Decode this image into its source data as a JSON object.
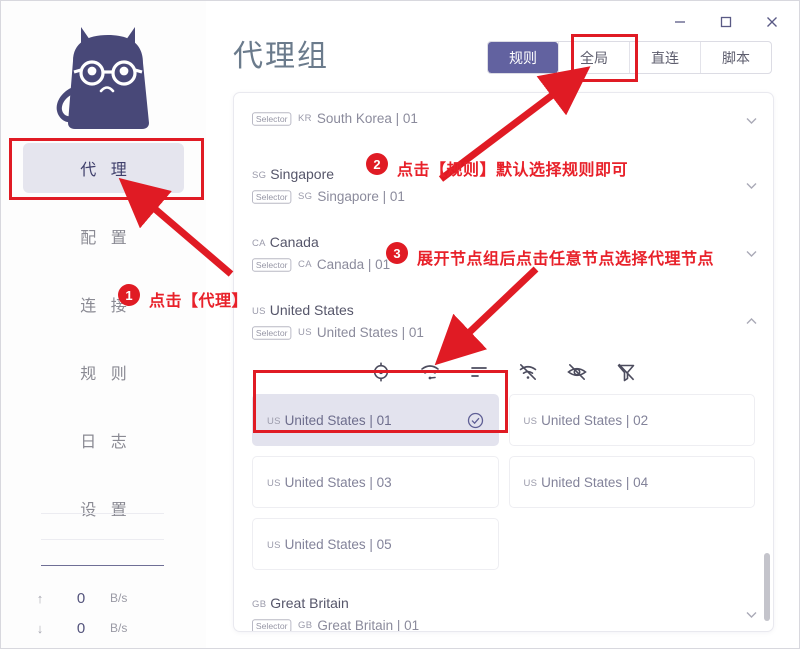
{
  "window": {
    "controls": [
      {
        "name": "minimize",
        "glyph": "minimize-icon"
      },
      {
        "name": "maximize",
        "glyph": "maximize-icon"
      },
      {
        "name": "close",
        "glyph": "close-icon"
      }
    ]
  },
  "sidebar": {
    "logo_alt": "cat-logo",
    "items": [
      {
        "label": "代 理",
        "active": true
      },
      {
        "label": "配 置",
        "active": false
      },
      {
        "label": "连 接",
        "active": false
      },
      {
        "label": "规 则",
        "active": false
      },
      {
        "label": "日 志",
        "active": false
      },
      {
        "label": "设 置",
        "active": false
      }
    ],
    "traffic": {
      "upload": {
        "icon": "arrow-up-icon",
        "value": "0",
        "unit": "B/s"
      },
      "download": {
        "icon": "arrow-down-icon",
        "value": "0",
        "unit": "B/s"
      }
    }
  },
  "main": {
    "page_title": "代理组",
    "mode_tabs": [
      {
        "label": "规则",
        "active": true
      },
      {
        "label": "全局",
        "active": false
      },
      {
        "label": "直连",
        "active": false
      },
      {
        "label": "脚本",
        "active": false
      }
    ]
  },
  "proxy_groups": [
    {
      "country_code": "KR",
      "name": "South Korea",
      "title_visible": false,
      "badge": "Selector",
      "current": "South Korea | 01",
      "expanded": false,
      "chevron": "chevron-down-icon"
    },
    {
      "country_code": "SG",
      "name": "Singapore",
      "title_visible": true,
      "badge": "Selector",
      "current": "Singapore | 01",
      "expanded": false,
      "chevron": "chevron-down-icon"
    },
    {
      "country_code": "CA",
      "name": "Canada",
      "title_visible": true,
      "badge": "Selector",
      "current": "Canada | 01",
      "expanded": false,
      "chevron": "chevron-down-icon"
    },
    {
      "country_code": "US",
      "name": "United States",
      "title_visible": true,
      "badge": "Selector",
      "current": "United States | 01",
      "expanded": true,
      "chevron": "chevron-up-icon",
      "toolbar": [
        "target-icon",
        "speed-test-icon",
        "sort-icon",
        "no-signal-icon",
        "eye-off-icon",
        "filter-off-icon"
      ],
      "nodes": [
        {
          "country_code": "US",
          "label": "United States | 01",
          "selected": true,
          "check": "check-circle-icon"
        },
        {
          "country_code": "US",
          "label": "United States | 02",
          "selected": false
        },
        {
          "country_code": "US",
          "label": "United States | 03",
          "selected": false
        },
        {
          "country_code": "US",
          "label": "United States | 04",
          "selected": false
        },
        {
          "country_code": "US",
          "label": "United States | 05",
          "selected": false
        }
      ]
    },
    {
      "country_code": "GB",
      "name": "Great Britain",
      "title_visible": true,
      "badge": "Selector",
      "current": "Great Britain | 01",
      "expanded": false,
      "chevron": "chevron-down-icon"
    }
  ],
  "annotations": [
    {
      "number": "1",
      "text": "点击【代理】"
    },
    {
      "number": "2",
      "text": "点击【规则】默认选择规则即可"
    },
    {
      "number": "3",
      "text": "展开节点组后点击任意节点选择代理节点"
    }
  ],
  "colors": {
    "accent": "#6262a0",
    "annotation": "#e01b24",
    "active_bg": "#e5e5ee",
    "logo": "#484878"
  }
}
